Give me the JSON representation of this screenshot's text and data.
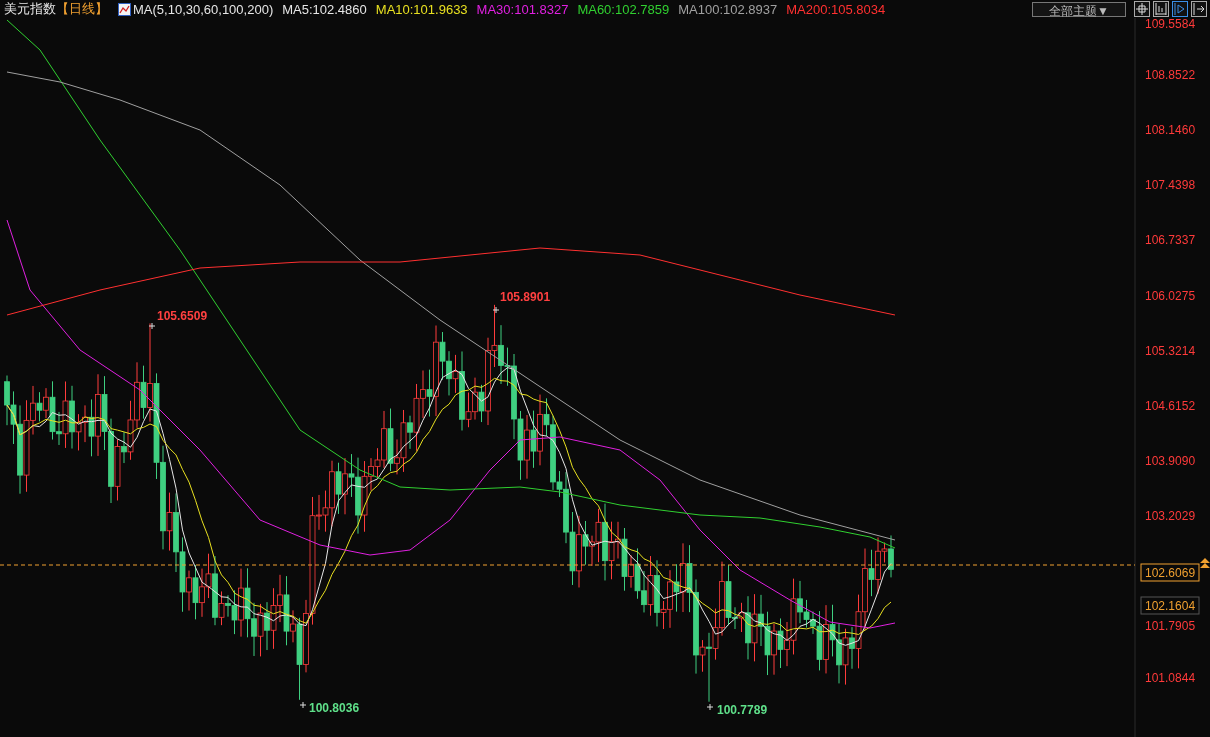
{
  "header": {
    "title": "美元指数",
    "period": "【日线】",
    "indicator": "MA(5,10,30,60,100,200)",
    "ma_legend": [
      {
        "label": "MA5:102.4860",
        "color": "#e6e6e6"
      },
      {
        "label": "MA10:101.9633",
        "color": "#e8e020"
      },
      {
        "label": "MA30:101.8327",
        "color": "#e020e0"
      },
      {
        "label": "MA60:102.7859",
        "color": "#30d030"
      },
      {
        "label": "MA100:102.8937",
        "color": "#a0a0a0"
      },
      {
        "label": "MA200:105.8034",
        "color": "#ff3030"
      }
    ]
  },
  "theme_dropdown": {
    "label": "全部主题▼"
  },
  "toolbar": [
    {
      "kind": "crosshair",
      "selected": false
    },
    {
      "kind": "range",
      "selected": false
    },
    {
      "kind": "play",
      "selected": true
    },
    {
      "kind": "exit",
      "selected": false
    }
  ],
  "chart": {
    "price_axis": [
      {
        "label": "109.5584",
        "kind": "tick"
      },
      {
        "label": "108.8522",
        "kind": "tick"
      },
      {
        "label": "108.1460",
        "kind": "tick"
      },
      {
        "label": "107.4398",
        "kind": "tick"
      },
      {
        "label": "106.7337",
        "kind": "tick"
      },
      {
        "label": "106.0275",
        "kind": "tick"
      },
      {
        "label": "105.3214",
        "kind": "tick"
      },
      {
        "label": "104.6152",
        "kind": "tick"
      },
      {
        "label": "103.9090",
        "kind": "tick"
      },
      {
        "label": "103.2029",
        "kind": "tick"
      },
      {
        "label": "102.6069",
        "kind": "current"
      },
      {
        "label": "102.1604",
        "kind": "cursor"
      },
      {
        "label": "101.7905",
        "kind": "tick"
      },
      {
        "label": "101.0844",
        "kind": "tick"
      }
    ],
    "annotations": [
      {
        "label": "105.6509",
        "kind": "high"
      },
      {
        "label": "105.8901",
        "kind": "high"
      },
      {
        "label": "100.8036",
        "kind": "low"
      },
      {
        "label": "100.7789",
        "kind": "low"
      }
    ]
  }
}
